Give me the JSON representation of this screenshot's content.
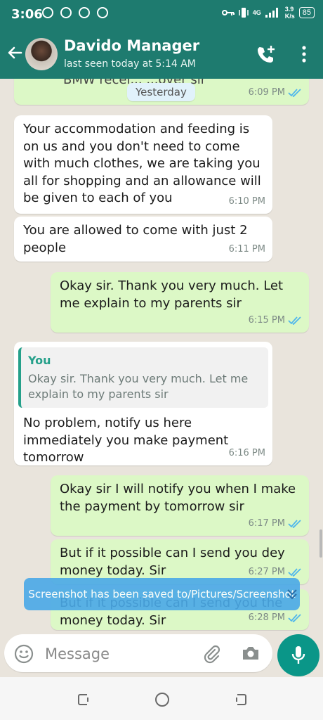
{
  "status_bar": {
    "time": "3:06",
    "network_type": "4G",
    "speed_value": "3.9",
    "speed_unit": "K/s",
    "battery": "85"
  },
  "header": {
    "contact_name": "Davido Manager",
    "last_seen": "last seen today at 5:14 AM"
  },
  "chat": {
    "partial_top_text": "BMW recei... ...over sir",
    "partial_top_time": "6:09 PM",
    "date_chip": "Yesterday",
    "messages": [
      {
        "direction": "in",
        "text": "Your accommodation and feeding is on us and you don't need to come with much clothes, we are taking you all for shopping and an allowance will be given to each of you",
        "time": "6:10 PM"
      },
      {
        "direction": "in",
        "text": "You are allowed to come with just 2 people",
        "time": "6:11 PM"
      },
      {
        "direction": "out",
        "text": "Okay sir. Thank you very much. Let me explain to my parents sir",
        "time": "6:15 PM"
      },
      {
        "direction": "in",
        "quote_name": "You",
        "quote_text": "Okay sir. Thank you very much. Let me explain to my parents sir",
        "text": "No problem, notify us here immediately you make payment tomorrow",
        "time": "6:16 PM"
      },
      {
        "direction": "out",
        "text": "Okay sir I will notify you when I make the payment by tomorrow sir",
        "time": "6:17 PM"
      },
      {
        "direction": "out",
        "text": "But if it possible can I send you dey money today. Sir",
        "time": "6:27 PM"
      },
      {
        "direction": "out",
        "text": "But if it possible can I send you the money today. Sir",
        "time": "6:28 PM"
      }
    ]
  },
  "toast": "Screenshot has been saved to/Pictures/Screenshot",
  "composer": {
    "placeholder": "Message"
  },
  "colors": {
    "header": "#1e7b6f",
    "outgoing_bubble": "#dcf8c6",
    "incoming_bubble": "#ffffff",
    "accent": "#0a9688",
    "read_ticks": "#4fb6ec"
  }
}
